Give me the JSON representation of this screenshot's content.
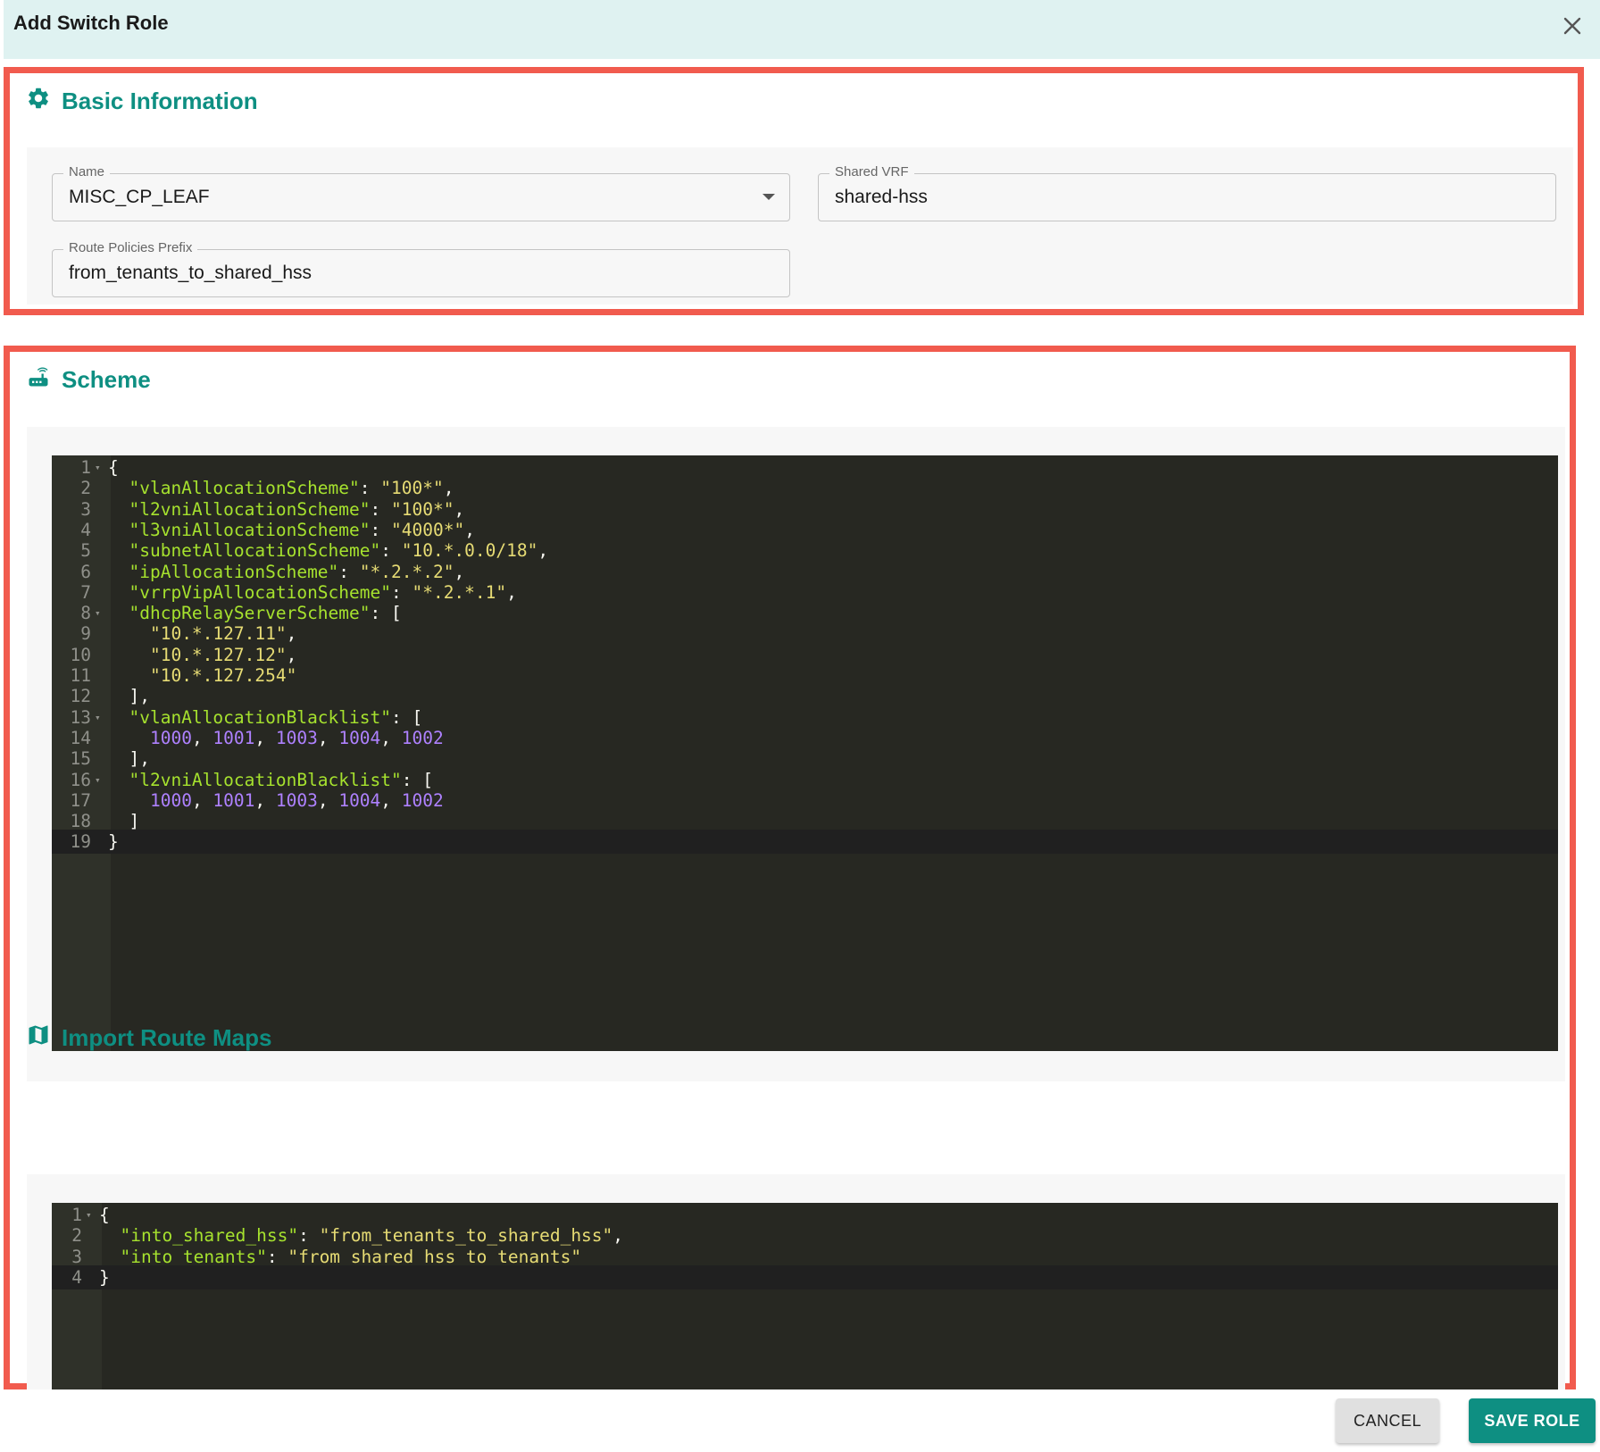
{
  "dialog": {
    "title": "Add Switch Role",
    "close_icon": "close-icon"
  },
  "basic_info": {
    "header": "Basic Information",
    "icon": "gear-icon",
    "name": {
      "label": "Name",
      "value": "MISC_CP_LEAF"
    },
    "shared_vrf": {
      "label": "Shared VRF",
      "value": "shared-hss"
    },
    "route_policies_prefix": {
      "label": "Route Policies Prefix",
      "value": "from_tenants_to_shared_hss"
    }
  },
  "scheme": {
    "header": "Scheme",
    "icon": "router-icon",
    "active_line": 19,
    "fold_lines": [
      1,
      8,
      13,
      16
    ],
    "lines": [
      [
        [
          "{",
          "p"
        ]
      ],
      [
        [
          "  ",
          "p"
        ],
        [
          "\"vlanAllocationScheme\"",
          "key"
        ],
        [
          ": ",
          "p"
        ],
        [
          "\"100*\"",
          "str"
        ],
        [
          ",",
          "p"
        ]
      ],
      [
        [
          "  ",
          "p"
        ],
        [
          "\"l2vniAllocationScheme\"",
          "key"
        ],
        [
          ": ",
          "p"
        ],
        [
          "\"100*\"",
          "str"
        ],
        [
          ",",
          "p"
        ]
      ],
      [
        [
          "  ",
          "p"
        ],
        [
          "\"l3vniAllocationScheme\"",
          "key"
        ],
        [
          ": ",
          "p"
        ],
        [
          "\"4000*\"",
          "str"
        ],
        [
          ",",
          "p"
        ]
      ],
      [
        [
          "  ",
          "p"
        ],
        [
          "\"subnetAllocationScheme\"",
          "key"
        ],
        [
          ": ",
          "p"
        ],
        [
          "\"10.*.0.0/18\"",
          "str"
        ],
        [
          ",",
          "p"
        ]
      ],
      [
        [
          "  ",
          "p"
        ],
        [
          "\"ipAllocationScheme\"",
          "key"
        ],
        [
          ": ",
          "p"
        ],
        [
          "\"*.2.*.2\"",
          "str"
        ],
        [
          ",",
          "p"
        ]
      ],
      [
        [
          "  ",
          "p"
        ],
        [
          "\"vrrpVipAllocationScheme\"",
          "key"
        ],
        [
          ": ",
          "p"
        ],
        [
          "\"*.2.*.1\"",
          "str"
        ],
        [
          ",",
          "p"
        ]
      ],
      [
        [
          "  ",
          "p"
        ],
        [
          "\"dhcpRelayServerScheme\"",
          "key"
        ],
        [
          ": [",
          "p"
        ]
      ],
      [
        [
          "    ",
          "p"
        ],
        [
          "\"10.*.127.11\"",
          "str"
        ],
        [
          ",",
          "p"
        ]
      ],
      [
        [
          "    ",
          "p"
        ],
        [
          "\"10.*.127.12\"",
          "str"
        ],
        [
          ",",
          "p"
        ]
      ],
      [
        [
          "    ",
          "p"
        ],
        [
          "\"10.*.127.254\"",
          "str"
        ]
      ],
      [
        [
          "  ],",
          "p"
        ]
      ],
      [
        [
          "  ",
          "p"
        ],
        [
          "\"vlanAllocationBlacklist\"",
          "key"
        ],
        [
          ": [",
          "p"
        ]
      ],
      [
        [
          "    ",
          "p"
        ],
        [
          "1000",
          "num"
        ],
        [
          ", ",
          "p"
        ],
        [
          "1001",
          "num"
        ],
        [
          ", ",
          "p"
        ],
        [
          "1003",
          "num"
        ],
        [
          ", ",
          "p"
        ],
        [
          "1004",
          "num"
        ],
        [
          ", ",
          "p"
        ],
        [
          "1002",
          "num"
        ]
      ],
      [
        [
          "  ],",
          "p"
        ]
      ],
      [
        [
          "  ",
          "p"
        ],
        [
          "\"l2vniAllocationBlacklist\"",
          "key"
        ],
        [
          ": [",
          "p"
        ]
      ],
      [
        [
          "    ",
          "p"
        ],
        [
          "1000",
          "num"
        ],
        [
          ", ",
          "p"
        ],
        [
          "1001",
          "num"
        ],
        [
          ", ",
          "p"
        ],
        [
          "1003",
          "num"
        ],
        [
          ", ",
          "p"
        ],
        [
          "1004",
          "num"
        ],
        [
          ", ",
          "p"
        ],
        [
          "1002",
          "num"
        ]
      ],
      [
        [
          "  ]",
          "p"
        ]
      ],
      [
        [
          "}",
          "p"
        ]
      ]
    ]
  },
  "import_route_maps": {
    "header": "Import Route Maps",
    "icon": "map-icon",
    "active_line": 4,
    "fold_lines": [
      1
    ],
    "lines": [
      [
        [
          "{",
          "p"
        ]
      ],
      [
        [
          "  ",
          "p"
        ],
        [
          "\"into_shared_hss\"",
          "key"
        ],
        [
          ": ",
          "p"
        ],
        [
          "\"from_tenants_to_shared_hss\"",
          "str"
        ],
        [
          ",",
          "p"
        ]
      ],
      [
        [
          "  ",
          "p"
        ],
        [
          "\"into_tenants\"",
          "key"
        ],
        [
          ": ",
          "p"
        ],
        [
          "\"from_shared_hss_to_tenants\"",
          "str"
        ]
      ],
      [
        [
          "}",
          "p"
        ]
      ]
    ]
  },
  "actions": {
    "cancel_label": "CANCEL",
    "save_label": "SAVE ROLE"
  },
  "colors": {
    "accent": "#0e8f82",
    "highlight_border": "#f15b4e",
    "titlebar_bg": "#dff2f1",
    "editor_bg": "#272822"
  }
}
